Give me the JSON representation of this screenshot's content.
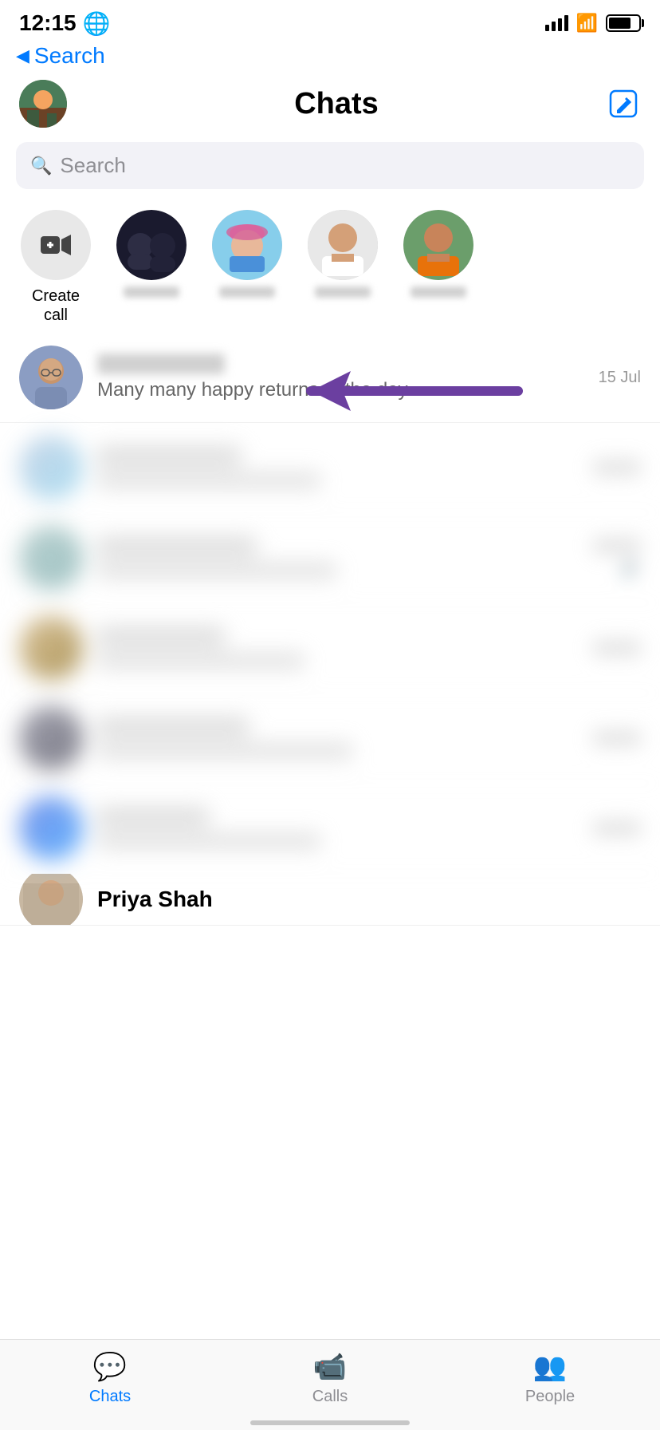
{
  "statusBar": {
    "time": "12:15",
    "globe": "🌐",
    "battery": "75"
  },
  "backNav": {
    "label": "Search"
  },
  "header": {
    "title": "Chats",
    "composeLabel": "compose"
  },
  "searchBar": {
    "placeholder": "Search"
  },
  "storyRow": {
    "createCall": {
      "label": "Create\ncall"
    }
  },
  "chatList": {
    "firstChat": {
      "preview": "Many many happy returns of the day·",
      "time": "15 Jul"
    }
  },
  "tabBar": {
    "chats": "Chats",
    "calls": "Calls",
    "people": "People"
  },
  "bottomIndicator": "—"
}
